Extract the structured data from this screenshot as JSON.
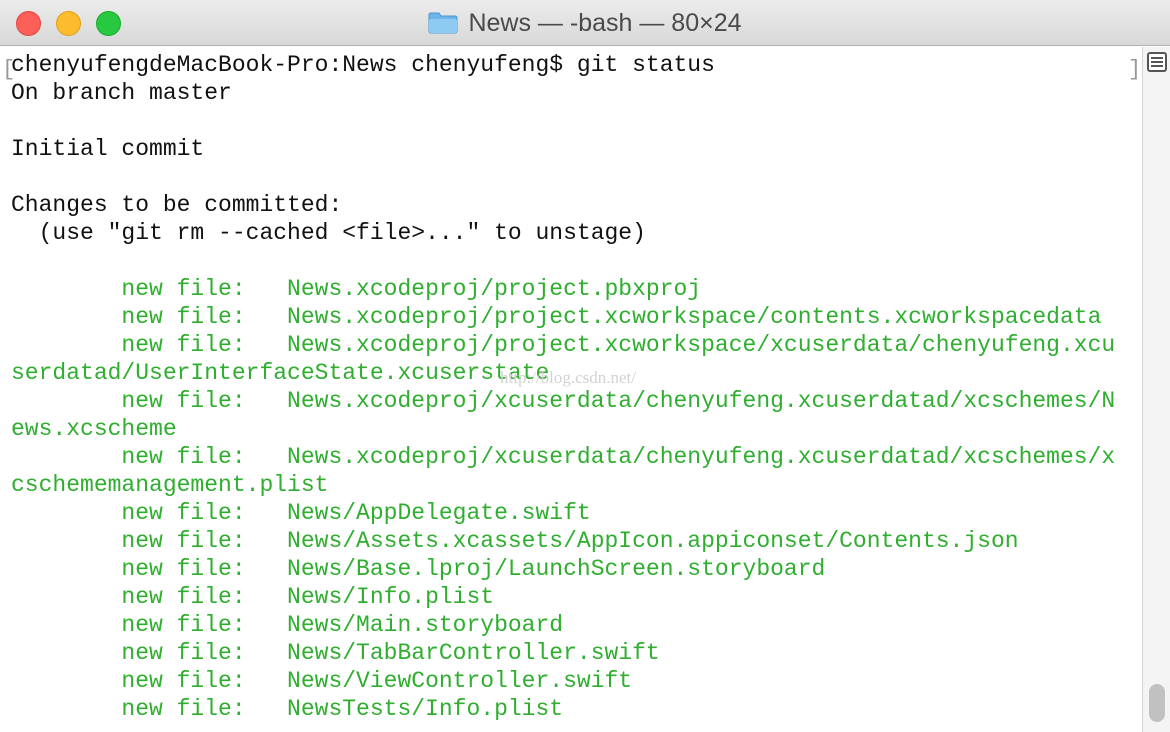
{
  "window": {
    "title": "News — -bash — 80×24",
    "folder_icon": "folder-icon"
  },
  "colors": {
    "green": "#2fae2f",
    "text": "#111111"
  },
  "terminal": {
    "lines": [
      {
        "text": "chenyufengdeMacBook-Pro:News chenyufeng$ git status",
        "color": "default"
      },
      {
        "text": "On branch master",
        "color": "default"
      },
      {
        "text": "",
        "color": "default"
      },
      {
        "text": "Initial commit",
        "color": "default"
      },
      {
        "text": "",
        "color": "default"
      },
      {
        "text": "Changes to be committed:",
        "color": "default"
      },
      {
        "text": "  (use \"git rm --cached <file>...\" to unstage)",
        "color": "default"
      },
      {
        "text": "",
        "color": "default"
      },
      {
        "text": "        new file:   News.xcodeproj/project.pbxproj",
        "color": "green"
      },
      {
        "text": "        new file:   News.xcodeproj/project.xcworkspace/contents.xcworkspacedata",
        "color": "green"
      },
      {
        "text": "        new file:   News.xcodeproj/project.xcworkspace/xcuserdata/chenyufeng.xcu",
        "color": "green"
      },
      {
        "text": "serdatad/UserInterfaceState.xcuserstate",
        "color": "green"
      },
      {
        "text": "        new file:   News.xcodeproj/xcuserdata/chenyufeng.xcuserdatad/xcschemes/N",
        "color": "green"
      },
      {
        "text": "ews.xcscheme",
        "color": "green"
      },
      {
        "text": "        new file:   News.xcodeproj/xcuserdata/chenyufeng.xcuserdatad/xcschemes/x",
        "color": "green"
      },
      {
        "text": "cschememanagement.plist",
        "color": "green"
      },
      {
        "text": "        new file:   News/AppDelegate.swift",
        "color": "green"
      },
      {
        "text": "        new file:   News/Assets.xcassets/AppIcon.appiconset/Contents.json",
        "color": "green"
      },
      {
        "text": "        new file:   News/Base.lproj/LaunchScreen.storyboard",
        "color": "green"
      },
      {
        "text": "        new file:   News/Info.plist",
        "color": "green"
      },
      {
        "text": "        new file:   News/Main.storyboard",
        "color": "green"
      },
      {
        "text": "        new file:   News/TabBarController.swift",
        "color": "green"
      },
      {
        "text": "        new file:   News/ViewController.swift",
        "color": "green"
      },
      {
        "text": "        new file:   NewsTests/Info.plist",
        "color": "green"
      }
    ],
    "watermark": "http://blog.csdn.net/"
  },
  "sidebar": {
    "split_icon": "split-pane-icon"
  }
}
